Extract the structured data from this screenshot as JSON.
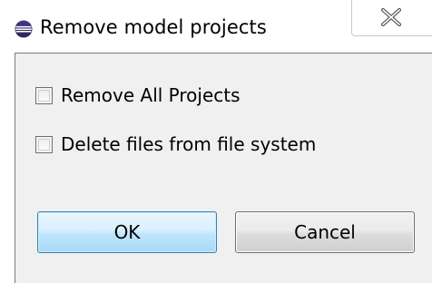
{
  "window": {
    "title": "Remove model projects",
    "app_icon": "eclipse-icon",
    "close_icon": "close-icon"
  },
  "options": [
    {
      "label": "Remove All Projects",
      "checked": false
    },
    {
      "label": "Delete files from file system",
      "checked": false
    }
  ],
  "buttons": {
    "ok_label": "OK",
    "cancel_label": "Cancel"
  },
  "colors": {
    "ok_border": "#3c7fb1",
    "client_background": "#f0f0f0"
  }
}
